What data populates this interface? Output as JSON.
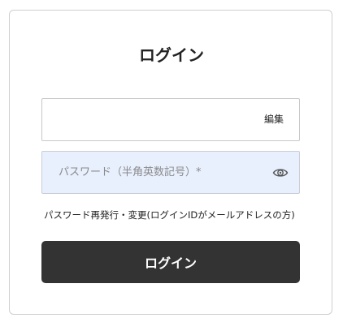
{
  "login": {
    "title": "ログイン",
    "user_field": {
      "value": "",
      "edit_label": "編集"
    },
    "password_field": {
      "value": "",
      "placeholder": "パスワード（半角英数記号）*",
      "toggle_icon": "eye-icon"
    },
    "forgot_password": "パスワード再発行・変更(ログインIDがメールアドレスの方)",
    "submit_label": "ログイン",
    "colors": {
      "button_bg": "#333333",
      "autofill_bg": "#e8f0fe",
      "border": "#c8c8c8"
    }
  }
}
